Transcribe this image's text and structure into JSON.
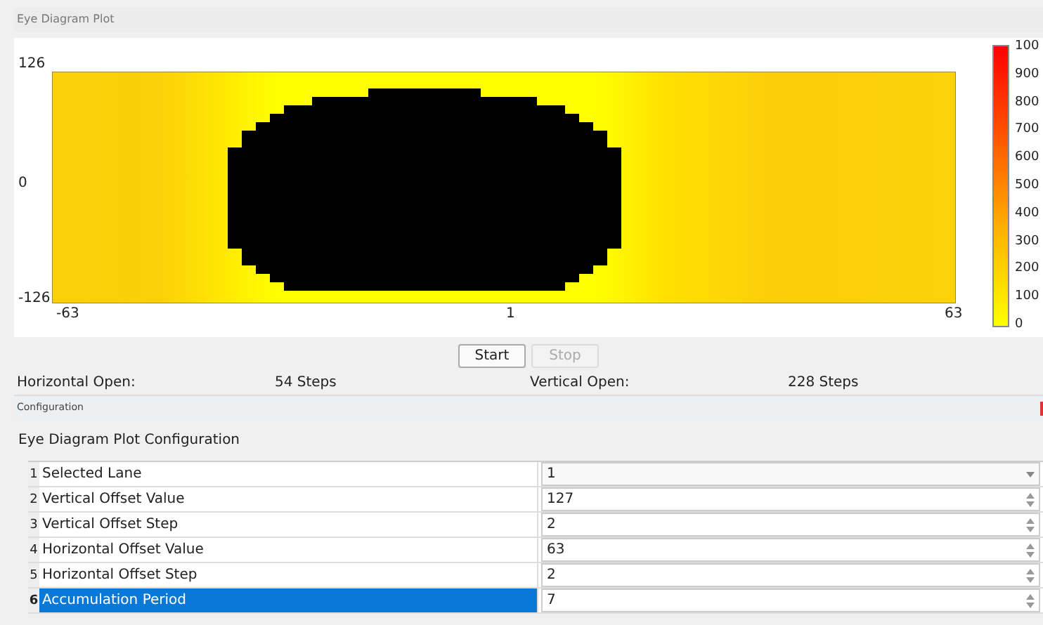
{
  "plot_panel": {
    "title": "Eye Diagram Plot",
    "y_ticks": [
      "126",
      "0",
      "-126"
    ],
    "x_ticks": [
      "-63",
      "1",
      "63"
    ],
    "colorbar_ticks": [
      "100",
      "900",
      "800",
      "700",
      "600",
      "500",
      "400",
      "300",
      "200",
      "100",
      "0"
    ]
  },
  "buttons": [
    {
      "label": "Start",
      "disabled": false
    },
    {
      "label": "Stop",
      "disabled": true
    }
  ],
  "results": [
    {
      "label": "Horizontal Open:",
      "value": "54 Steps"
    },
    {
      "label": "Vertical Open:",
      "value": "228 Steps"
    }
  ],
  "config_panel": {
    "title": "Configuration",
    "heading": "Eye Diagram Plot Configuration",
    "rows": [
      {
        "index": "1",
        "name": "Selected Lane",
        "value": "1",
        "kind": "dropdown",
        "selected": false
      },
      {
        "index": "2",
        "name": "Vertical Offset Value",
        "value": "127",
        "kind": "spinbox",
        "selected": false
      },
      {
        "index": "3",
        "name": "Vertical Offset Step",
        "value": "2",
        "kind": "spinbox",
        "selected": false
      },
      {
        "index": "4",
        "name": "Horizontal Offset Value",
        "value": "63",
        "kind": "spinbox",
        "selected": false
      },
      {
        "index": "5",
        "name": "Horizontal Offset Step",
        "value": "2",
        "kind": "spinbox",
        "selected": false
      },
      {
        "index": "6",
        "name": "Accumulation Period",
        "value": "7",
        "kind": "spinbox",
        "selected": true
      }
    ]
  }
}
